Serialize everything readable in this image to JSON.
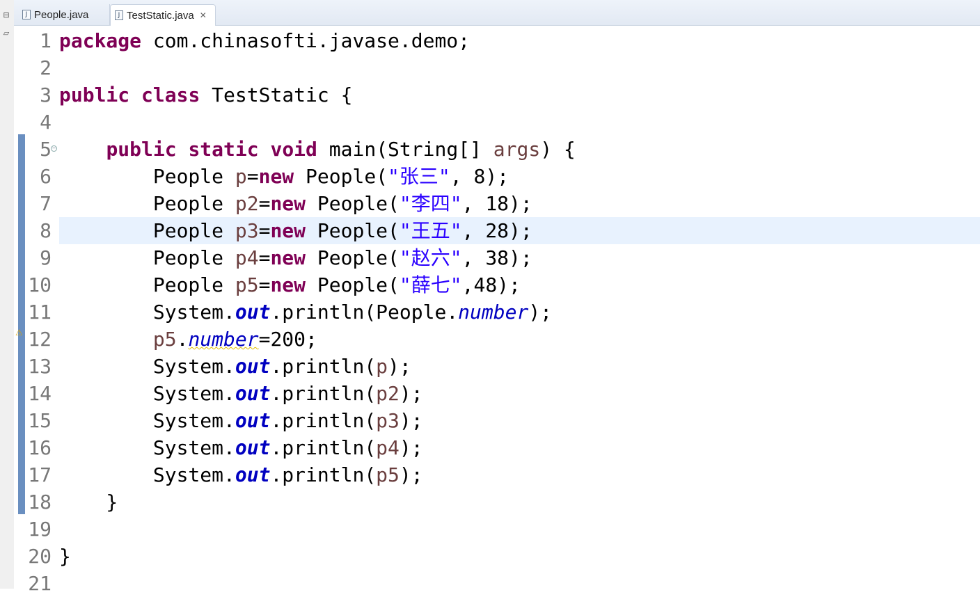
{
  "tabs": [
    {
      "label": "People.java",
      "active": false,
      "icon": "java-file-icon"
    },
    {
      "label": "TestStatic.java",
      "active": true,
      "icon": "java-file-icon"
    }
  ],
  "colors": {
    "keyword": "#7f0055",
    "string": "#2a00ff",
    "field": "#0000c0",
    "variable": "#6a3e3e",
    "line_number": "#787878",
    "current_line": "#e8f2fe"
  },
  "current_line": 8,
  "lines": [
    {
      "n": "1",
      "tokens": [
        {
          "t": "package",
          "c": "kw"
        },
        {
          "t": " com.chinasofti.javase.demo;"
        }
      ]
    },
    {
      "n": "2",
      "tokens": []
    },
    {
      "n": "3",
      "tokens": [
        {
          "t": "public",
          "c": "kw"
        },
        {
          "t": " "
        },
        {
          "t": "class",
          "c": "kw"
        },
        {
          "t": " TestStatic {"
        }
      ]
    },
    {
      "n": "4",
      "tokens": []
    },
    {
      "n": "5",
      "tokens": [
        {
          "t": "    "
        },
        {
          "t": "public",
          "c": "kw"
        },
        {
          "t": " "
        },
        {
          "t": "static",
          "c": "kw"
        },
        {
          "t": " "
        },
        {
          "t": "void",
          "c": "kw"
        },
        {
          "t": " main(String[] "
        },
        {
          "t": "args",
          "c": "var"
        },
        {
          "t": ") {"
        }
      ]
    },
    {
      "n": "6",
      "tokens": [
        {
          "t": "        People "
        },
        {
          "t": "p",
          "c": "var"
        },
        {
          "t": "="
        },
        {
          "t": "new",
          "c": "kw"
        },
        {
          "t": " People("
        },
        {
          "t": "\"张三\"",
          "c": "str"
        },
        {
          "t": ", 8);"
        }
      ]
    },
    {
      "n": "7",
      "tokens": [
        {
          "t": "        People "
        },
        {
          "t": "p2",
          "c": "var"
        },
        {
          "t": "="
        },
        {
          "t": "new",
          "c": "kw"
        },
        {
          "t": " People("
        },
        {
          "t": "\"李四\"",
          "c": "str"
        },
        {
          "t": ", 18);"
        }
      ]
    },
    {
      "n": "8",
      "tokens": [
        {
          "t": "        People "
        },
        {
          "t": "p3",
          "c": "var"
        },
        {
          "t": "="
        },
        {
          "t": "new",
          "c": "kw"
        },
        {
          "t": " People("
        },
        {
          "t": "\"王五\"",
          "c": "str"
        },
        {
          "t": ", 28);"
        }
      ]
    },
    {
      "n": "9",
      "tokens": [
        {
          "t": "        People "
        },
        {
          "t": "p4",
          "c": "var"
        },
        {
          "t": "="
        },
        {
          "t": "new",
          "c": "kw"
        },
        {
          "t": " People("
        },
        {
          "t": "\"赵六\"",
          "c": "str"
        },
        {
          "t": ", 38);"
        }
      ]
    },
    {
      "n": "10",
      "tokens": [
        {
          "t": "        People "
        },
        {
          "t": "p5",
          "c": "var"
        },
        {
          "t": "="
        },
        {
          "t": "new",
          "c": "kw"
        },
        {
          "t": " People("
        },
        {
          "t": "\"薛七\"",
          "c": "str"
        },
        {
          "t": ",48);"
        }
      ]
    },
    {
      "n": "11",
      "tokens": [
        {
          "t": "        System."
        },
        {
          "t": "out",
          "c": "sfld"
        },
        {
          "t": ".println(People."
        },
        {
          "t": "number",
          "c": "fld"
        },
        {
          "t": ");"
        }
      ]
    },
    {
      "n": "12",
      "tokens": [
        {
          "t": "        "
        },
        {
          "t": "p5",
          "c": "var"
        },
        {
          "t": "."
        },
        {
          "t": "number",
          "c": "fld warn"
        },
        {
          "t": "=200;"
        }
      ]
    },
    {
      "n": "13",
      "tokens": [
        {
          "t": "        System."
        },
        {
          "t": "out",
          "c": "sfld"
        },
        {
          "t": ".println("
        },
        {
          "t": "p",
          "c": "var"
        },
        {
          "t": ");"
        }
      ]
    },
    {
      "n": "14",
      "tokens": [
        {
          "t": "        System."
        },
        {
          "t": "out",
          "c": "sfld"
        },
        {
          "t": ".println("
        },
        {
          "t": "p2",
          "c": "var"
        },
        {
          "t": ");"
        }
      ]
    },
    {
      "n": "15",
      "tokens": [
        {
          "t": "        System."
        },
        {
          "t": "out",
          "c": "sfld"
        },
        {
          "t": ".println("
        },
        {
          "t": "p3",
          "c": "var"
        },
        {
          "t": ");"
        }
      ]
    },
    {
      "n": "16",
      "tokens": [
        {
          "t": "        System."
        },
        {
          "t": "out",
          "c": "sfld"
        },
        {
          "t": ".println("
        },
        {
          "t": "p4",
          "c": "var"
        },
        {
          "t": ");"
        }
      ]
    },
    {
      "n": "17",
      "tokens": [
        {
          "t": "        System."
        },
        {
          "t": "out",
          "c": "sfld"
        },
        {
          "t": ".println("
        },
        {
          "t": "p5",
          "c": "var"
        },
        {
          "t": ");"
        }
      ]
    },
    {
      "n": "18",
      "tokens": [
        {
          "t": "    }"
        }
      ]
    },
    {
      "n": "19",
      "tokens": []
    },
    {
      "n": "20",
      "tokens": [
        {
          "t": "}"
        }
      ]
    },
    {
      "n": "21",
      "tokens": []
    }
  ]
}
